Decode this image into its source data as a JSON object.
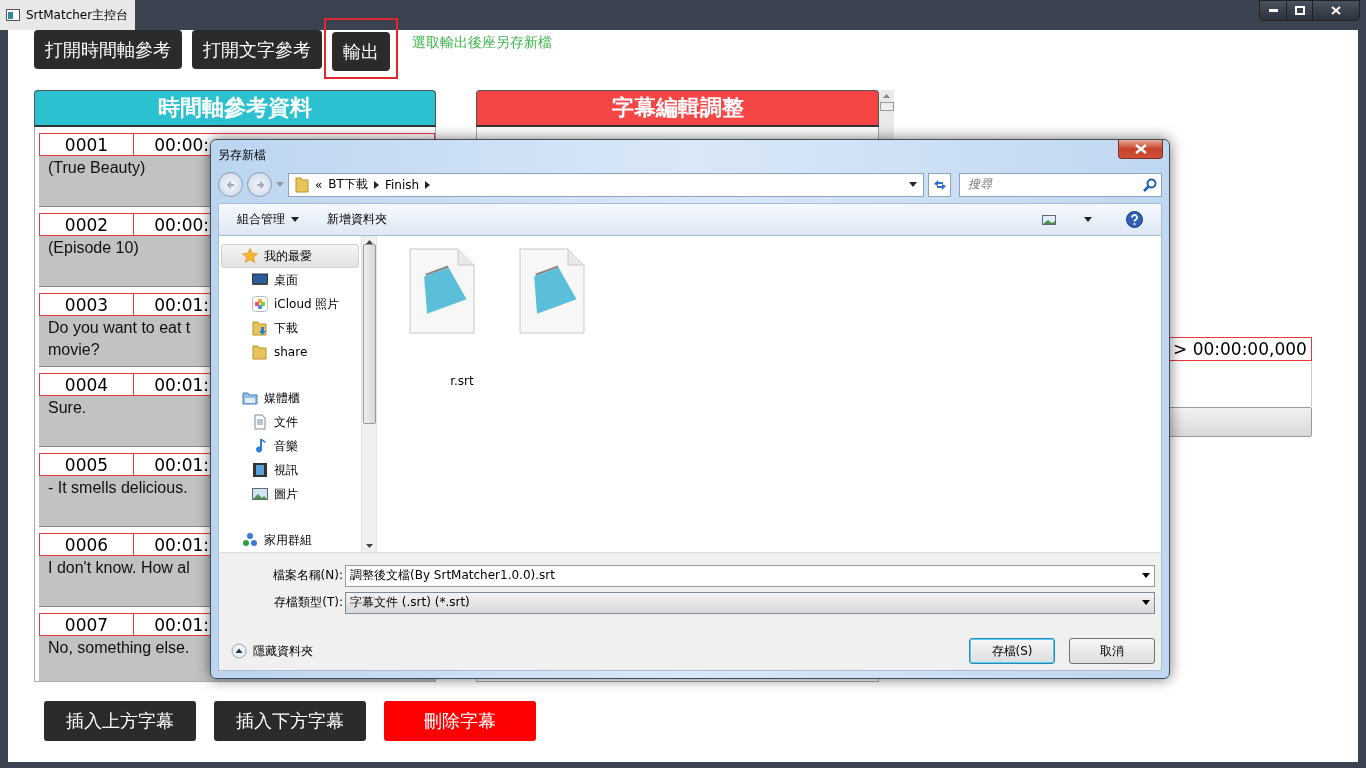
{
  "window": {
    "title": "SrtMatcher主控台"
  },
  "toolbar": {
    "buttons": [
      {
        "label": "打開時間軸參考",
        "highlighted": false
      },
      {
        "label": "打開文字參考",
        "highlighted": false
      },
      {
        "label": "輸出",
        "highlighted": true
      }
    ],
    "hint": "選取輸出後座另存新檔"
  },
  "timeline_panel": {
    "title": "時間軸參考資料",
    "rows": [
      {
        "index": "0001",
        "time": "00:00:",
        "lines": [
          "(True Beauty)"
        ]
      },
      {
        "index": "0002",
        "time": "00:00:",
        "lines": [
          "(Episode 10)"
        ]
      },
      {
        "index": "0003",
        "time": "00:01:",
        "lines": [
          "Do you want to eat t",
          "movie?"
        ]
      },
      {
        "index": "0004",
        "time": "00:01:",
        "lines": [
          "Sure."
        ]
      },
      {
        "index": "0005",
        "time": "00:01:",
        "lines": [
          "- It smells delicious."
        ]
      },
      {
        "index": "0006",
        "time": "00:01:",
        "lines": [
          "I don't know. How al"
        ]
      },
      {
        "index": "0007",
        "time": "00:01:",
        "lines": [
          "No, something else."
        ]
      }
    ]
  },
  "edit_panel": {
    "title": "字幕編輯調整",
    "time": "> 00:00:00,000"
  },
  "bottom_buttons": [
    {
      "label": "插入上方字幕",
      "kind": "normal"
    },
    {
      "label": "插入下方字幕",
      "kind": "normal"
    },
    {
      "label": "刪除字幕",
      "kind": "danger"
    }
  ],
  "dialog": {
    "title": "另存新檔",
    "overflow_mark": "«",
    "breadcrumbs": [
      "BT下載",
      "Finish"
    ],
    "search_placeholder": "搜尋",
    "commands": [
      {
        "label": "組合管理",
        "kind": "menu"
      },
      {
        "label": "新增資料夾",
        "kind": "plain"
      }
    ],
    "nav": [
      {
        "label": "我的最愛",
        "kind": "star",
        "selected": true,
        "children": [
          {
            "label": "桌面",
            "kind": "desktop",
            "selected": false
          },
          {
            "label": "iCloud 照片",
            "kind": "photos",
            "selected": false
          },
          {
            "label": "下載",
            "kind": "download",
            "selected": false
          },
          {
            "label": "share",
            "kind": "folder",
            "selected": false
          }
        ]
      },
      {
        "label": "媒體櫃",
        "kind": "library",
        "selected": false,
        "children": [
          {
            "label": "文件",
            "kind": "document",
            "selected": false
          },
          {
            "label": "音樂",
            "kind": "music",
            "selected": false
          },
          {
            "label": "視訊",
            "kind": "video",
            "selected": false
          },
          {
            "label": "圖片",
            "kind": "image",
            "selected": false
          }
        ]
      },
      {
        "label": "家用群組",
        "kind": "homegroup",
        "selected": false
      }
    ],
    "files": [
      {
        "kind": "text-file",
        "label": "r.srt"
      },
      {
        "kind": "text-file"
      }
    ],
    "filename_label": "檔案名稱(N):",
    "filename": "調整後文檔(By SrtMatcher1.0.0).srt",
    "type_label": "存檔類型(T):",
    "type": "字幕文件 (.srt) (*.srt)",
    "hide_folders": "隱藏資料夾",
    "buttons": [
      {
        "label": "存檔(S)",
        "default": true
      },
      {
        "label": "取消",
        "default": false
      }
    ]
  }
}
